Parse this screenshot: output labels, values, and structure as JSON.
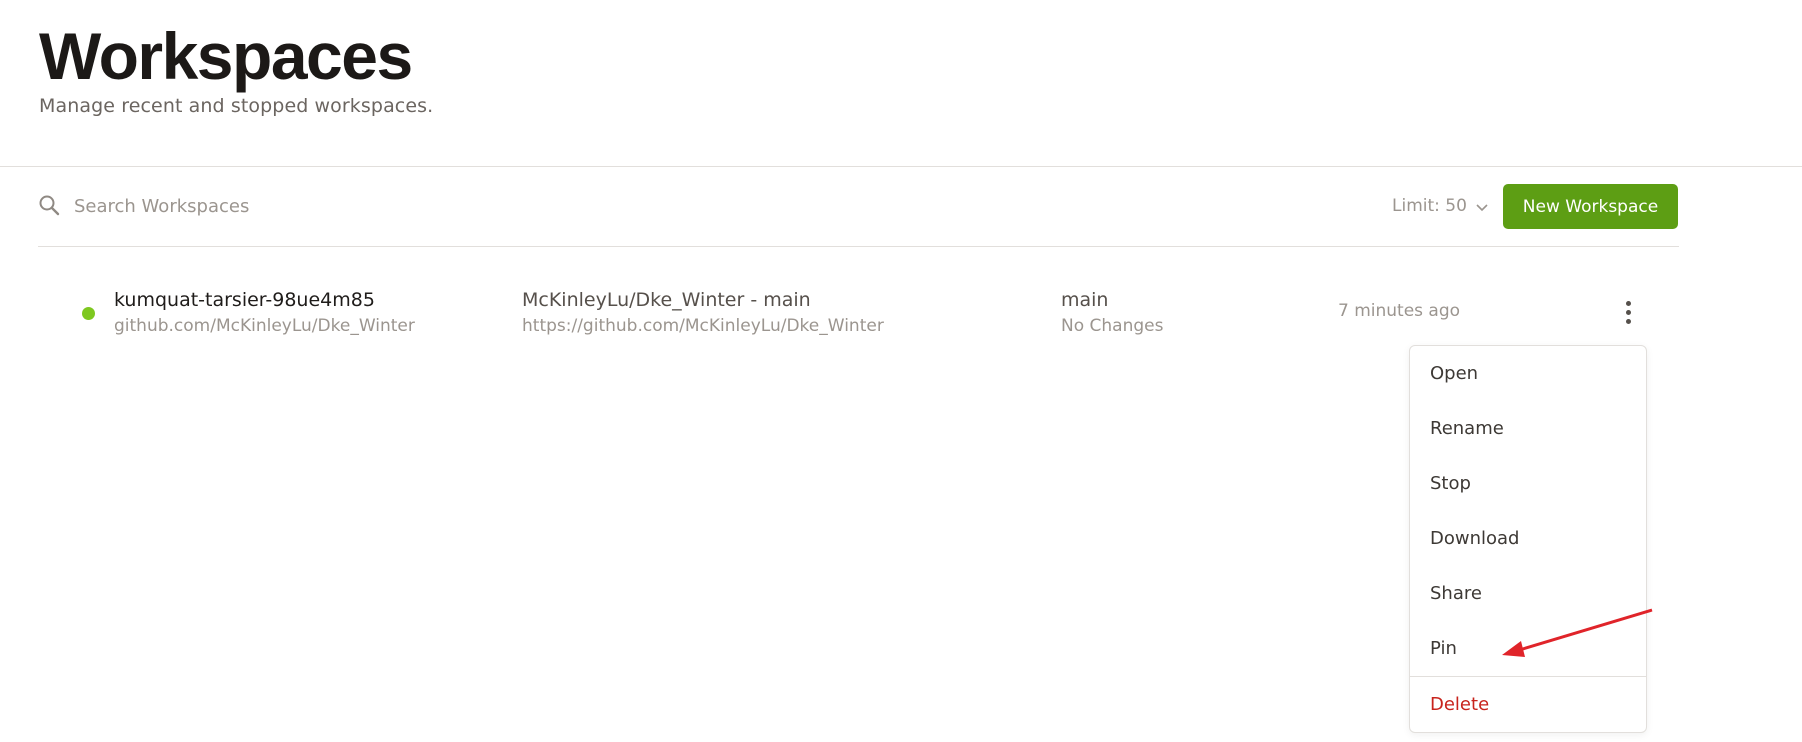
{
  "header": {
    "title": "Workspaces",
    "subtitle": "Manage recent and stopped workspaces."
  },
  "toolbar": {
    "search_placeholder": "Search Workspaces",
    "limit_label": "Limit: 50",
    "new_button_label": "New Workspace"
  },
  "workspaces": [
    {
      "name": "kumquat-tarsier-98ue4m85",
      "context": "github.com/McKinleyLu/Dke_Winter",
      "repo_title": "McKinleyLu/Dke_Winter - main",
      "repo_url": "https://github.com/McKinleyLu/Dke_Winter",
      "branch": "main",
      "changes": "No Changes",
      "last_active": "7 minutes ago",
      "status": "running"
    }
  ],
  "menu": {
    "items": [
      "Open",
      "Rename",
      "Stop",
      "Download",
      "Share",
      "Pin"
    ],
    "danger_item": "Delete"
  },
  "colors": {
    "accent_green": "#5d9e14",
    "status_running": "#7ec820",
    "danger_red": "#c8231c",
    "annotation_arrow": "#e0242a"
  }
}
